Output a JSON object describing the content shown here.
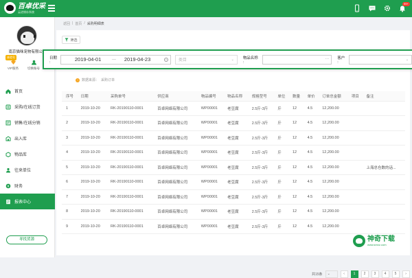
{
  "header": {
    "logo_title": "百卓优采",
    "logo_subtitle": "云进销存系统",
    "notification_count": "99+"
  },
  "sidebar": {
    "shop_name": "南京猫咪宠物有限公司",
    "member_tag": "体验号",
    "quick": [
      {
        "label": "VIP服务"
      },
      {
        "label": "切换账号"
      }
    ],
    "items": [
      {
        "label": "首页",
        "icon": "home-icon"
      },
      {
        "label": "采购/在线订货",
        "icon": "purchase-icon"
      },
      {
        "label": "销售/在线分销",
        "icon": "sales-icon"
      },
      {
        "label": "出入库",
        "icon": "warehouse-icon"
      },
      {
        "label": "物品库",
        "icon": "items-icon"
      },
      {
        "label": "往来单位",
        "icon": "partners-icon"
      },
      {
        "label": "财务",
        "icon": "finance-icon"
      },
      {
        "label": "报表中心",
        "icon": "report-icon",
        "active": true
      }
    ],
    "find_supply": "寻找货源"
  },
  "breadcrumb": [
    "返回",
    "首页",
    "采购明细表"
  ],
  "filter": {
    "button": "筛选",
    "date_label": "日期 :",
    "date_start": "2019-04-01",
    "date_sep": "—",
    "date_end": "2019-04-23",
    "category_placeholder": "类目",
    "item_label": "物品名称 :",
    "customer_label": "客户 :"
  },
  "source": {
    "label": "数据来源：",
    "value": "采购订单"
  },
  "table": {
    "headers": [
      "序号",
      "日期",
      "采购单号",
      "供应商",
      "物品编号",
      "物品名称",
      "规格型号",
      "单位",
      "数量",
      "单价",
      "订单总金额",
      "项目",
      "备注"
    ],
    "rows": [
      [
        "1",
        "2019-10-20",
        "RK-20190110-0001",
        "百卓网络有限公司",
        "WP00001",
        "老豆腐",
        "2.5斤-3斤",
        "斤",
        "12",
        "4.5",
        "12,200.00",
        "",
        ""
      ],
      [
        "2",
        "2019-10-20",
        "RK-20190110-0001",
        "百卓网络有限公司",
        "WP00001",
        "老豆腐",
        "2.5斤-3斤",
        "斤",
        "12",
        "4.5",
        "12,200.00",
        "",
        ""
      ],
      [
        "3",
        "2019-10-20",
        "RK-20190110-0001",
        "百卓网络有限公司",
        "WP00001",
        "老豆腐",
        "2.5斤-3斤",
        "斤",
        "12",
        "4.5",
        "12,200.00",
        "",
        ""
      ],
      [
        "4",
        "2019-10-20",
        "RK-20190110-0001",
        "百卓网络有限公司",
        "WP00001",
        "老豆腐",
        "2.5斤-3斤",
        "斤",
        "12",
        "4.5",
        "12,200.00",
        "",
        ""
      ],
      [
        "5",
        "2019-10-20",
        "RK-20190110-0001",
        "百卓网络有限公司",
        "WP00001",
        "老豆腐",
        "2.5斤-3斤",
        "斤",
        "12",
        "4.5",
        "12,200.00",
        "",
        "上海总仓数的话..."
      ],
      [
        "6",
        "2019-10-20",
        "RK-20190110-0001",
        "百卓网络有限公司",
        "WP00001",
        "老豆腐",
        "2.5斤-3斤",
        "斤",
        "12",
        "4.5",
        "12,200.00",
        "",
        ""
      ],
      [
        "7",
        "2019-10-20",
        "RK-20190110-0001",
        "百卓网络有限公司",
        "WP00001",
        "老豆腐",
        "2.5斤-3斤",
        "斤",
        "12",
        "4.5",
        "12,200.00",
        "",
        ""
      ],
      [
        "8",
        "2019-10-20",
        "RK-20190110-0001",
        "百卓网络有限公司",
        "WP00001",
        "老豆腐",
        "2.5斤-3斤",
        "斤",
        "12",
        "4.5",
        "12,200.00",
        "",
        ""
      ],
      [
        "9",
        "2019-10-20",
        "RK-20190110-0001",
        "百卓网络有限公司",
        "WP00001",
        "老豆腐",
        "2.5斤-3斤",
        "斤",
        "12",
        "4.5",
        "12,200.00",
        "",
        ""
      ]
    ]
  },
  "pager": {
    "total": "共15条",
    "page_size": "",
    "pages": [
      "1",
      "2",
      "3",
      "4",
      "5"
    ],
    "current": "1"
  },
  "watermark": {
    "title": "神奇下载",
    "subtitle": "www.smxz.com"
  },
  "colors": {
    "brand": "#1f9e4f"
  }
}
